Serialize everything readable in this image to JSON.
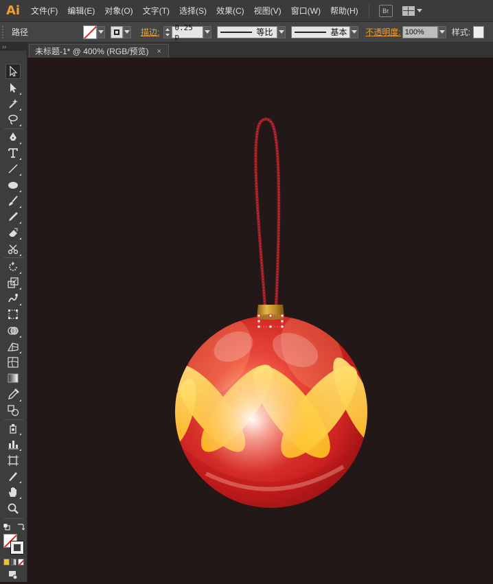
{
  "app": {
    "logo": "Ai"
  },
  "menu": {
    "items": [
      "文件(F)",
      "编辑(E)",
      "对象(O)",
      "文字(T)",
      "选择(S)",
      "效果(C)",
      "视图(V)",
      "窗口(W)",
      "帮助(H)"
    ],
    "bridge_label": "Br"
  },
  "control": {
    "object_type": "路径",
    "stroke_label": "描边:",
    "stroke_weight": "0.25 p",
    "profile_label": "等比",
    "brush_label": "基本",
    "opacity_label": "不透明度:",
    "opacity_value": "100%",
    "style_label": "样式:",
    "accent_color": "#f0a030"
  },
  "document": {
    "tab_title": "未标题-1* @ 400% (RGB/预览)",
    "close_glyph": "×"
  },
  "toolbar": {
    "grip": "››",
    "tools": [
      "selection-tool",
      "direct-selection-tool",
      "magic-wand-tool",
      "lasso-tool",
      "pen-tool",
      "type-tool",
      "line-segment-tool",
      "ellipse-tool",
      "paintbrush-tool",
      "pencil-tool",
      "eraser-tool",
      "scissors-tool",
      "rotate-tool",
      "scale-tool",
      "warp-tool",
      "free-transform-tool",
      "shape-builder-tool",
      "perspective-grid-tool",
      "mesh-tool",
      "gradient-tool",
      "eyedropper-tool",
      "blend-tool",
      "symbol-sprayer-tool",
      "column-graph-tool",
      "artboard-tool",
      "slice-tool",
      "hand-tool",
      "zoom-tool"
    ]
  },
  "artwork": {
    "canvas_color": "#231818",
    "ornament_color": "#d42a22",
    "pattern_color": "#ffd23c",
    "cap_color": "#c9962c",
    "string_color": "#8a1c22"
  }
}
